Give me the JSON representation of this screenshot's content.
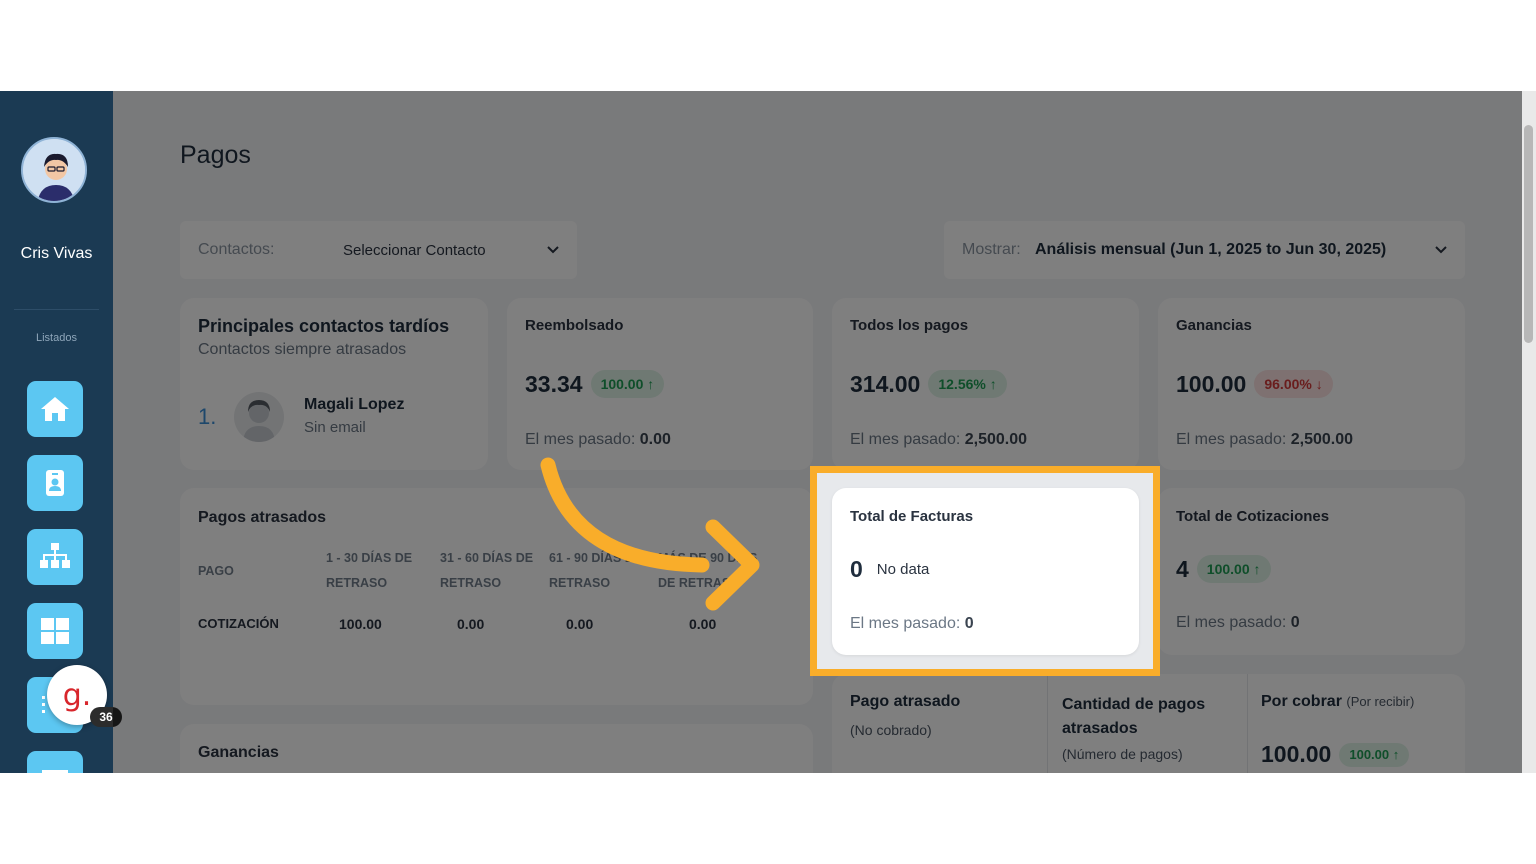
{
  "sidebar": {
    "user_name": "Cris Vivas",
    "section_label": "Listados",
    "buttons": [
      {
        "icon": "home-icon"
      },
      {
        "icon": "contact-card-icon"
      },
      {
        "icon": "org-chart-icon"
      },
      {
        "icon": "grid-icon"
      },
      {
        "icon": "list-icon"
      },
      {
        "icon": "mail-icon"
      }
    ],
    "badge": {
      "letter": "g.",
      "count": "36"
    }
  },
  "header": {
    "title": "Pagos"
  },
  "filters": {
    "contacts_label": "Contactos:",
    "contacts_value": "Seleccionar Contacto",
    "show_label": "Mostrar:",
    "show_value": "Análisis mensual (Jun 1, 2025 to Jun 30, 2025)"
  },
  "late_contacts": {
    "title": "Principales contactos tardíos",
    "subtitle": "Contactos siempre atrasados",
    "rank": "1.",
    "name": "Magali Lopez",
    "email": "Sin email"
  },
  "metrics": {
    "refunded": {
      "title": "Reembolsado",
      "value": "33.34",
      "change": "100.00 ↑",
      "prev_label": "El mes pasado:",
      "prev_value": "0.00"
    },
    "all_payments": {
      "title": "Todos los pagos",
      "value": "314.00",
      "change": "12.56% ↑",
      "prev_label": "El mes pasado:",
      "prev_value": "2,500.00"
    },
    "earnings": {
      "title": "Ganancias",
      "value": "100.00",
      "change": "96.00% ↓",
      "prev_label": "El mes pasado:",
      "prev_value": "2,500.00"
    },
    "invoices": {
      "title": "Total de Facturas",
      "value": "0",
      "change": "No data",
      "prev_label": "El mes pasado:",
      "prev_value": "0"
    },
    "quotes": {
      "title": "Total de Cotizaciones",
      "value": "4",
      "change": "100.00 ↑",
      "prev_label": "El mes pasado:",
      "prev_value": "0"
    }
  },
  "late_payments": {
    "title": "Pagos atrasados",
    "columns": [
      "PAGO",
      "1 - 30 DÍAS DE RETRASO",
      "31 - 60 DÍAS DE RETRASO",
      "61 - 90 DÍAS DE RETRASO",
      "MÁS DE 90 DÍAS DE RETRASO"
    ],
    "row": [
      "COTIZACIÓN",
      "100.00",
      "0.00",
      "0.00",
      "0.00"
    ]
  },
  "earnings_section": {
    "title": "Ganancias"
  },
  "bottom_stats": {
    "overdue": {
      "title": "Pago atrasado",
      "subtitle": "(No cobrado)"
    },
    "count": {
      "title": "Cantidad de pagos atrasados",
      "subtitle": "(Número de pagos)"
    },
    "receivable": {
      "title": "Por cobrar",
      "subtitle": "(Por recibir)",
      "value": "100.00",
      "change": "100.00 ↑"
    }
  },
  "colors": {
    "accent": "#f9ad2a",
    "sidebar": "#1b3a53",
    "side_button": "#5cc7f2"
  }
}
